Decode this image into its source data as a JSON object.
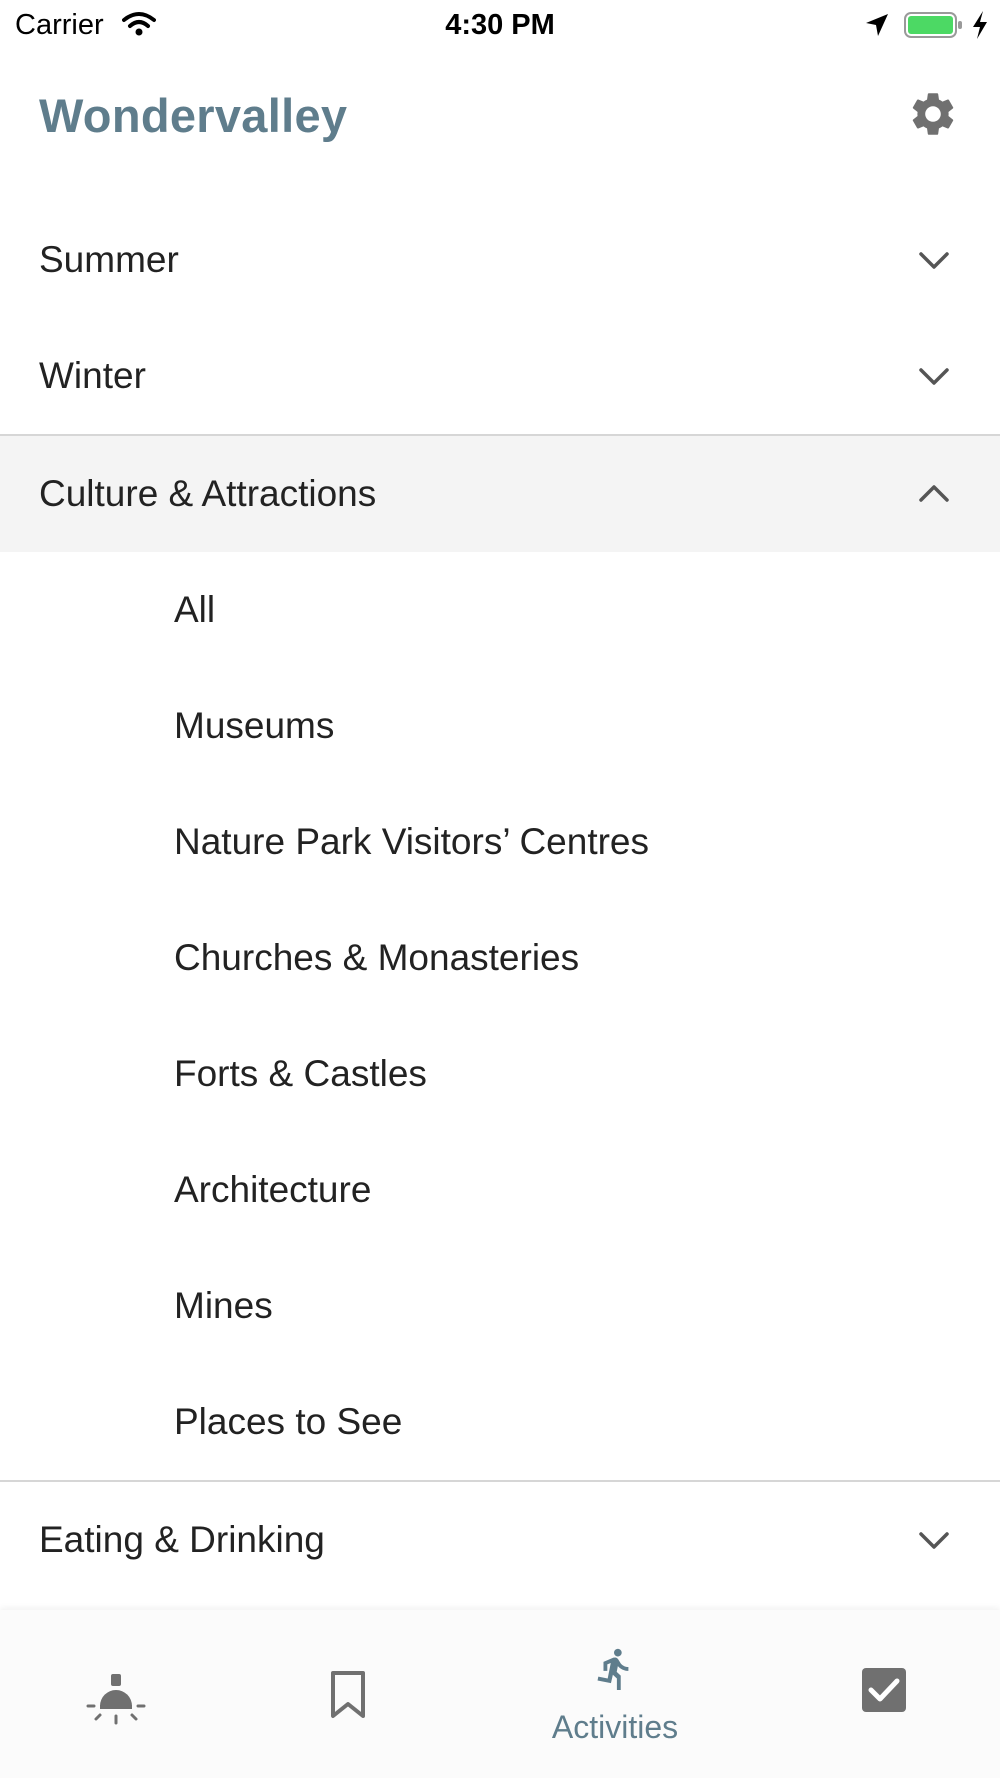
{
  "status_bar": {
    "carrier": "Carrier",
    "time": "4:30 PM"
  },
  "header": {
    "title": "Wondervalley",
    "settings_icon": "gear-icon"
  },
  "colors": {
    "accent": "#5f7d8c",
    "icon_gray": "#707070",
    "expanded_bg": "#f4f4f4",
    "battery": "#4cd964"
  },
  "menu": {
    "sections": [
      {
        "label": "Summer",
        "expanded": false
      },
      {
        "label": "Winter",
        "expanded": false
      },
      {
        "label": "Culture & Attractions",
        "expanded": true
      },
      {
        "label": "Eating & Drinking",
        "expanded": false
      }
    ],
    "culture_items": [
      "All",
      "Museums",
      "Nature Park Visitors’ Centres",
      "Churches & Monasteries",
      "Forts & Castles",
      "Architecture",
      "Mines",
      "Places to See"
    ]
  },
  "tabbar": {
    "tabs": [
      {
        "icon": "bulb-icon",
        "label": "",
        "active": false
      },
      {
        "icon": "bookmark-icon",
        "label": "",
        "active": false
      },
      {
        "icon": "running-icon",
        "label": "Activities",
        "active": true
      },
      {
        "icon": "checkbox-icon",
        "label": "",
        "active": false
      }
    ]
  }
}
